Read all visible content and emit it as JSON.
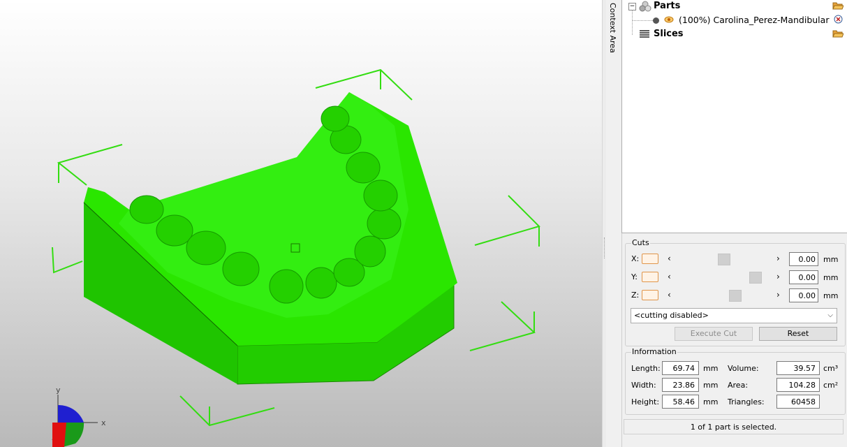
{
  "viewport": {
    "model_color": "#22ee00",
    "bbox_color": "#33dd11",
    "axis_labels": {
      "x": "x",
      "y": "y"
    }
  },
  "context_area": {
    "tab_label": "Context Area"
  },
  "tree": {
    "parts": {
      "label": "Parts",
      "icon": "parts-icon",
      "open_icon": "folder-open-icon"
    },
    "part_item": {
      "label": "(100%) Carolina_Perez-Mandibular",
      "visibility_icon": "eye-icon",
      "remove_icon": "remove-circle-icon"
    },
    "slices": {
      "label": "Slices",
      "icon": "slices-icon",
      "open_icon": "folder-open-icon"
    }
  },
  "cuts": {
    "title": "Cuts",
    "rows": [
      {
        "axis": "X:",
        "value": "0.00",
        "unit": "mm",
        "slider_fraction": 0.5
      },
      {
        "axis": "Y:",
        "value": "0.00",
        "unit": "mm",
        "slider_fraction": 0.83
      },
      {
        "axis": "Z:",
        "value": "0.00",
        "unit": "mm",
        "slider_fraction": 0.6
      }
    ],
    "mode_select": "<cutting disabled>",
    "execute_label": "Execute Cut",
    "reset_label": "Reset"
  },
  "information": {
    "title": "Information",
    "length_label": "Length:",
    "length_value": "69.74",
    "length_unit": "mm",
    "width_label": "Width:",
    "width_value": "23.86",
    "width_unit": "mm",
    "height_label": "Height:",
    "height_value": "58.46",
    "height_unit": "mm",
    "volume_label": "Volume:",
    "volume_value": "39.57",
    "volume_unit": "cm³",
    "area_label": "Area:",
    "area_value": "104.28",
    "area_unit": "cm²",
    "triangles_label": "Triangles:",
    "triangles_value": "60458"
  },
  "status_text": "1 of 1 part is selected."
}
